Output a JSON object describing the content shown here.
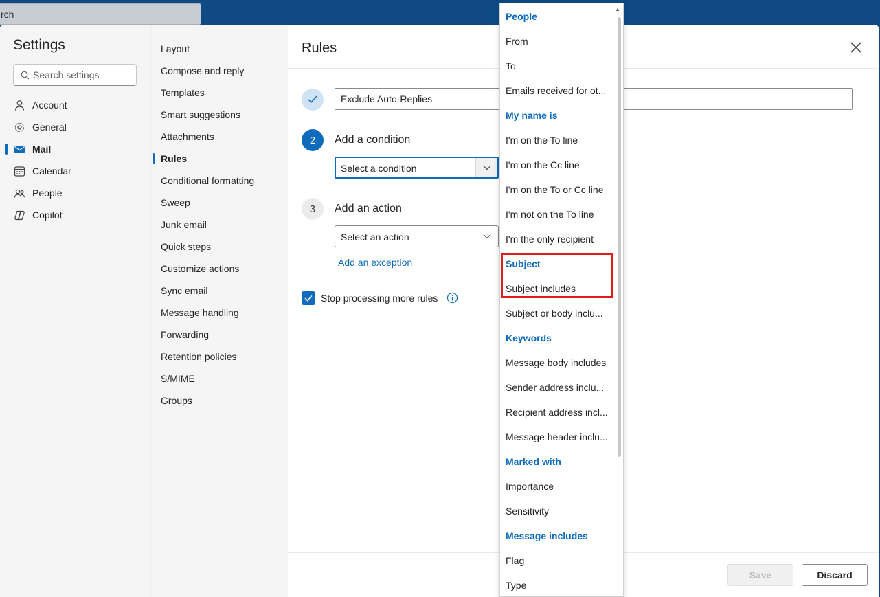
{
  "topbar": {
    "search_text": "rch"
  },
  "settings": {
    "title": "Settings",
    "search_placeholder": "Search settings",
    "nav": [
      {
        "label": "Account",
        "icon": "person-icon"
      },
      {
        "label": "General",
        "icon": "gear-icon"
      },
      {
        "label": "Mail",
        "icon": "mail-icon",
        "active": true
      },
      {
        "label": "Calendar",
        "icon": "calendar-icon"
      },
      {
        "label": "People",
        "icon": "people-icon"
      },
      {
        "label": "Copilot",
        "icon": "copilot-icon"
      }
    ],
    "subnav": [
      "Layout",
      "Compose and reply",
      "Templates",
      "Smart suggestions",
      "Attachments",
      "Rules",
      "Conditional formatting",
      "Sweep",
      "Junk email",
      "Quick steps",
      "Customize actions",
      "Sync email",
      "Message handling",
      "Forwarding",
      "Retention policies",
      "S/MIME",
      "Groups"
    ],
    "subnav_active": "Rules"
  },
  "rules": {
    "title": "Rules",
    "rule_name": "Exclude Auto-Replies",
    "step2_number": "2",
    "step2_label": "Add a condition",
    "condition_placeholder": "Select a condition",
    "step3_number": "3",
    "step3_label": "Add an action",
    "action_placeholder": "Select an action",
    "add_exception": "Add an exception",
    "stop_processing_label": "Stop processing more rules",
    "stop_processing_checked": true,
    "save_label": "Save",
    "discard_label": "Discard"
  },
  "dropdown": {
    "items": [
      {
        "label": "People",
        "header": true
      },
      {
        "label": "From"
      },
      {
        "label": "To"
      },
      {
        "label": "Emails received for ot..."
      },
      {
        "label": "My name is",
        "header": true
      },
      {
        "label": "I'm on the To line"
      },
      {
        "label": "I'm on the Cc line"
      },
      {
        "label": "I'm on the To or Cc line"
      },
      {
        "label": "I'm not on the To line"
      },
      {
        "label": "I'm the only recipient"
      },
      {
        "label": "Subject",
        "header": true
      },
      {
        "label": "Subject includes"
      },
      {
        "label": "Subject or body inclu..."
      },
      {
        "label": "Keywords",
        "header": true
      },
      {
        "label": "Message body includes"
      },
      {
        "label": "Sender address inclu..."
      },
      {
        "label": "Recipient address incl..."
      },
      {
        "label": "Message header inclu..."
      },
      {
        "label": "Marked with",
        "header": true
      },
      {
        "label": "Importance"
      },
      {
        "label": "Sensitivity"
      },
      {
        "label": "Message includes",
        "header": true
      },
      {
        "label": "Flag"
      },
      {
        "label": "Type"
      }
    ]
  },
  "colors": {
    "accent": "#0f6cbd",
    "highlight": "#e11c1c",
    "topbar": "#0f4a85"
  }
}
